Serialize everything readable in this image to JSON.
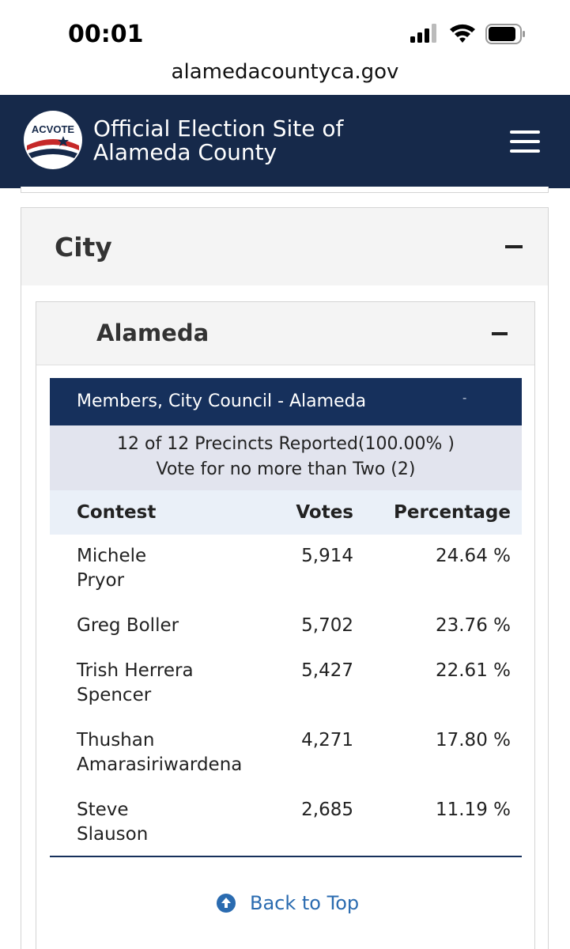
{
  "status_bar": {
    "time": "00:01",
    "icons": [
      "signal-icon",
      "wifi-icon",
      "battery-icon"
    ]
  },
  "browser": {
    "url": "alamedacountyca.gov"
  },
  "header": {
    "logo_text": "ACVOTE",
    "title_line1": "Official Election Site of",
    "title_line2": "Alameda County",
    "menu_icon": "hamburger-menu-icon"
  },
  "city_panel": {
    "title": "City",
    "toggle": "−"
  },
  "alameda_panel": {
    "title": "Alameda",
    "toggle": "−"
  },
  "contest": {
    "name": "Members, City Council - Alameda",
    "marker": "-",
    "precincts": "12 of 12 Precincts Reported(100.00% )",
    "vote_rule": "Vote for no more than Two (2)",
    "columns": {
      "contest": "Contest",
      "votes": "Votes",
      "percentage": "Percentage"
    },
    "candidates": [
      {
        "name_line1": "Michele",
        "name_line2": "Pryor",
        "votes": "5,914",
        "percentage": "24.64 %"
      },
      {
        "name_line1": "Greg Boller",
        "name_line2": "",
        "votes": "5,702",
        "percentage": "23.76 %"
      },
      {
        "name_line1": "Trish Herrera",
        "name_line2": "Spencer",
        "votes": "5,427",
        "percentage": "22.61 %"
      },
      {
        "name_line1": "Thushan",
        "name_line2": "Amarasiriwardena",
        "votes": "4,271",
        "percentage": "17.80 %"
      },
      {
        "name_line1": "Steve",
        "name_line2": "Slauson",
        "votes": "2,685",
        "percentage": "11.19 %"
      }
    ]
  },
  "back_to_top": {
    "label": "Back to Top",
    "icon": "arrow-up-circle-icon"
  },
  "colors": {
    "header_navy": "#16294a",
    "contest_bar": "#16305c",
    "precinct_bg": "#e2e4ee",
    "table_head_bg": "#eaf0f8",
    "link_blue": "#2a6bb0"
  }
}
